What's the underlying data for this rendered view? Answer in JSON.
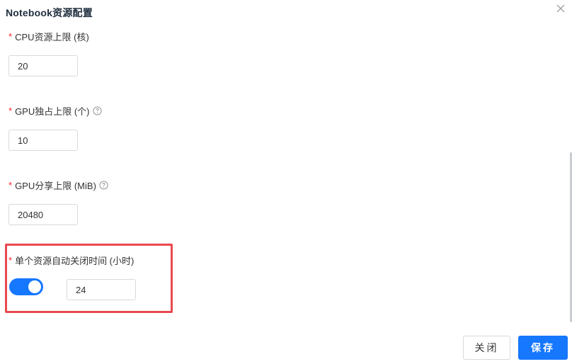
{
  "dialog": {
    "title": "Notebook资源配置",
    "close_icon": "close-icon"
  },
  "fields": {
    "cpu": {
      "required_mark": "*",
      "label": "CPU资源上限 (核)",
      "value": "20"
    },
    "gpu_exclusive": {
      "required_mark": "*",
      "label": "GPU独占上限 (个)",
      "help_icon": "question-circle-icon",
      "value": "10"
    },
    "gpu_share": {
      "required_mark": "*",
      "label": "GPU分享上限 (MiB)",
      "help_icon": "question-circle-icon",
      "value": "20480"
    },
    "auto_close": {
      "required_mark": "*",
      "label": "单个资源自动关闭时间 (小时)",
      "toggle_on": true,
      "value": "24"
    }
  },
  "footer": {
    "close_label": "关闭",
    "save_label": "保存"
  },
  "colors": {
    "primary": "#1677ff",
    "required": "#f5222d",
    "highlight_border": "#e8494f"
  }
}
